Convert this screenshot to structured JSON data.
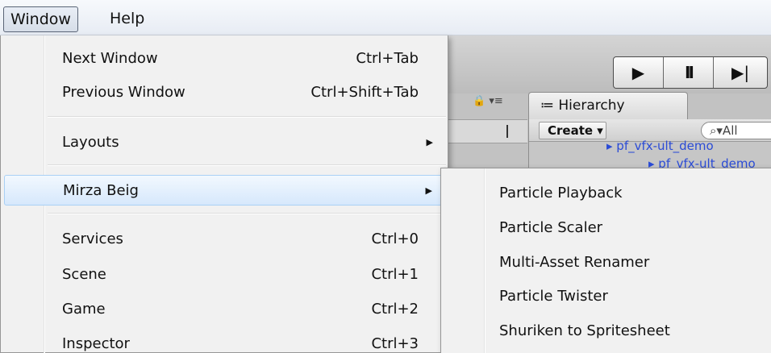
{
  "menubar": {
    "items": [
      {
        "label": "Window"
      },
      {
        "label": "Help"
      }
    ]
  },
  "editor": {
    "play_icon": "▶",
    "pause_icon": "II",
    "step_icon": "▶|",
    "lock_icons": "🔒 ▾≡",
    "hierarchy_tab": "≔ Hierarchy",
    "create_label": "Create ▾",
    "search_placeholder": "⌕▾All",
    "rows": [
      "▸ pf_vfx-ult_demo",
      "▸ pf_vfx-ult_demo"
    ]
  },
  "window_menu": {
    "items": [
      {
        "label": "Next Window",
        "shortcut": "Ctrl+Tab"
      },
      {
        "label": "Previous Window",
        "shortcut": "Ctrl+Shift+Tab"
      },
      {
        "label": "Layouts",
        "arrow": "▶"
      },
      {
        "label": "Mirza Beig",
        "arrow": "▶"
      },
      {
        "label": "Services",
        "shortcut": "Ctrl+0"
      },
      {
        "label": "Scene",
        "shortcut": "Ctrl+1"
      },
      {
        "label": "Game",
        "shortcut": "Ctrl+2"
      },
      {
        "label": "Inspector",
        "shortcut": "Ctrl+3"
      }
    ]
  },
  "mirza_submenu": {
    "items": [
      {
        "label": "Particle Playback"
      },
      {
        "label": "Particle Scaler"
      },
      {
        "label": "Multi-Asset Renamer"
      },
      {
        "label": "Particle Twister"
      },
      {
        "label": "Shuriken to Spritesheet"
      }
    ]
  },
  "colors": {
    "highlight": "#d6e8fc",
    "menu_bg": "#f1f1f1",
    "hierarchy_link": "#2a4bd6"
  }
}
